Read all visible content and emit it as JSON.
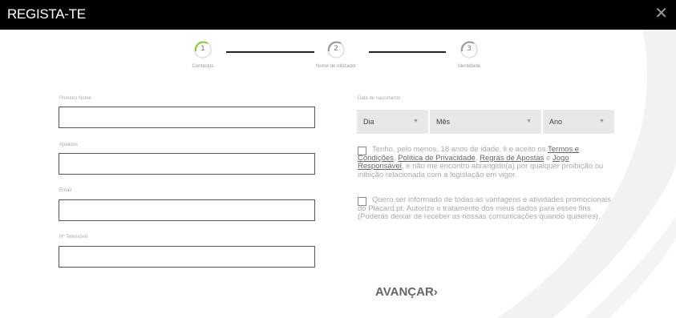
{
  "header": {
    "title": "REGISTA-TE",
    "close_glyph": "✕"
  },
  "stepper": {
    "steps": [
      {
        "num": "1",
        "label": "Contactos",
        "accent": "#8dc63f"
      },
      {
        "num": "2",
        "label": "Nome de utilizador",
        "accent": "#999999"
      },
      {
        "num": "3",
        "label": "Identidade",
        "accent": "#999999"
      }
    ]
  },
  "form": {
    "first_name_label": "Primeiro Nome",
    "surname_label": "Apelidos",
    "email_label": "Email",
    "phone_label": "Nº Telemóvel",
    "dob_label": "Data de nascimento",
    "day": "Dia",
    "month": "Mês",
    "year": "Ano"
  },
  "terms": {
    "t1": "Tenho, pelo menos, 18 anos de idade, li e aceito os ",
    "link_terms": "Termos e Condições",
    "sep1": ", ",
    "link_privacy": "Política de Privacidade",
    "sep2": ", ",
    "link_rules": "Regras de Apostas",
    "sep3": " e ",
    "link_responsible": "Jogo Responsável",
    "t2": ", e não me encontro abrangido(a) por qualquer proibição ou inibição relacionada com a legislação em vigor.",
    "marketing": "Quero ser informado de todas as vantagens e atividades promocionais do Placard.pt. Autorizo o tratamento dos meus dados para esses fins. (Poderás deixar de receber as nossas comunicações quando quiseres)."
  },
  "actions": {
    "next_label": "AVANÇAR",
    "next_arrow": "›"
  },
  "colors": {
    "header_bg": "#000000",
    "accent_green": "#8dc63f",
    "input_border": "#555555",
    "select_bg": "#e8e8e8"
  }
}
